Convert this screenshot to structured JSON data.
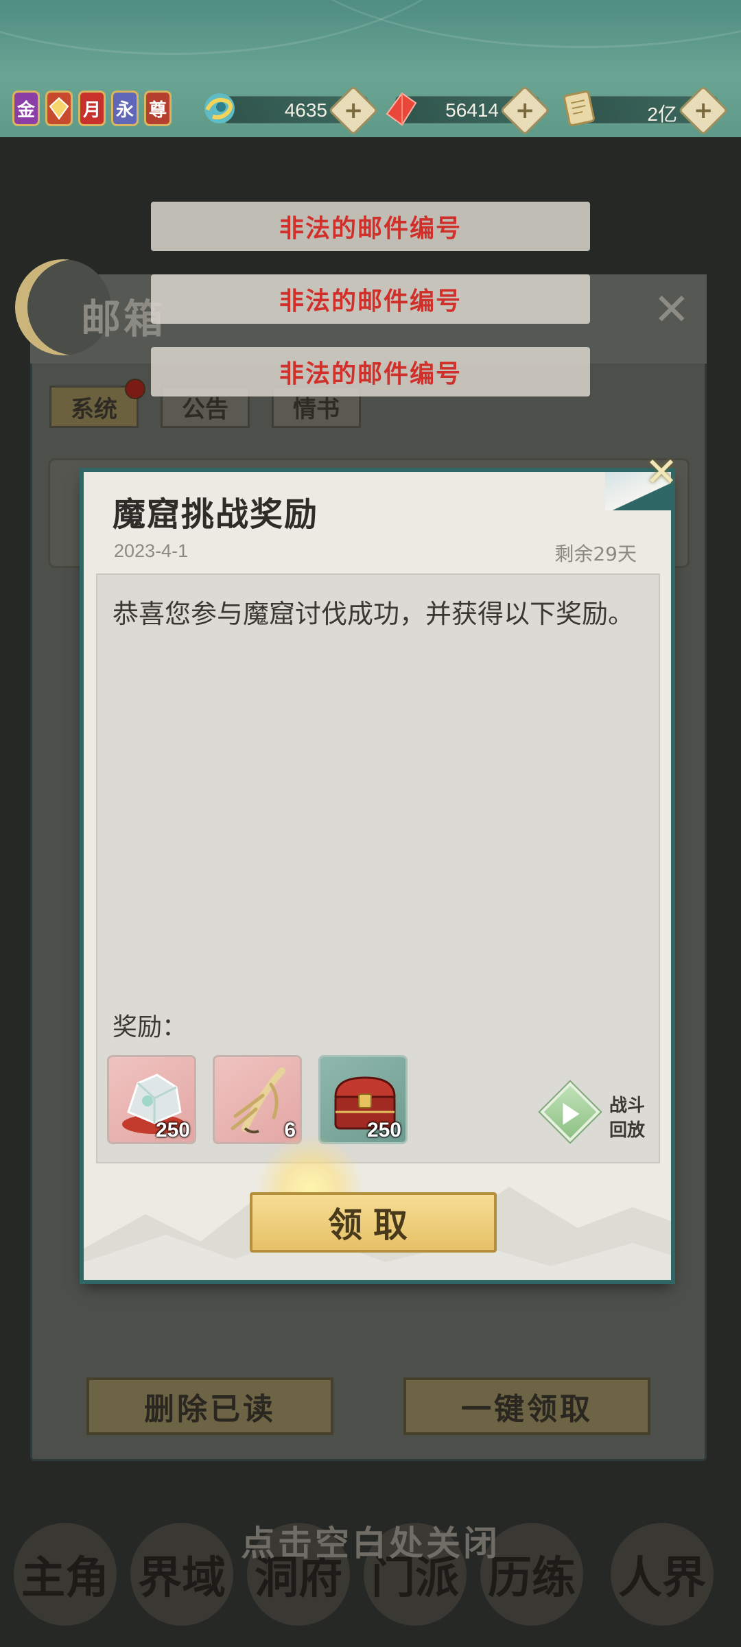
{
  "topbar": {
    "badges": [
      {
        "label": "金",
        "icon": "gold-badge-icon",
        "color": "#8c3ea7"
      },
      {
        "label": "",
        "icon": "treasure-badge-icon",
        "color": "#c84a2e"
      },
      {
        "label": "月",
        "icon": "month-card-icon",
        "color": "#c8302b"
      },
      {
        "label": "永",
        "icon": "permanent-card-icon",
        "color": "#6067b8"
      },
      {
        "label": "尊",
        "icon": "vip-badge-icon",
        "color": "#b6402f"
      }
    ],
    "resources": [
      {
        "icon": "jade-swirl-icon",
        "value": "4635"
      },
      {
        "icon": "red-crystal-icon",
        "value": "56414"
      },
      {
        "icon": "scroll-icon",
        "value": "2亿"
      }
    ]
  },
  "toasts": [
    "非法的邮件编号",
    "非法的邮件编号",
    "非法的邮件编号"
  ],
  "mailbox": {
    "title": "邮箱",
    "tabs": [
      "系统",
      "公告",
      "情书"
    ],
    "delete_read": "删除已读",
    "claim_all": "一键领取"
  },
  "mail": {
    "title": "魔窟挑战奖励",
    "date": "2023-4-1",
    "remaining": "剩余29天",
    "body": "恭喜您参与魔窟讨伐成功，并获得以下奖励。",
    "reward_label": "奖励：",
    "rewards": [
      {
        "icon": "spirit-stone-icon",
        "count": "250"
      },
      {
        "icon": "ginseng-root-icon",
        "count": "6"
      },
      {
        "icon": "treasure-chest-icon",
        "count": "250"
      }
    ],
    "replay_line1": "战斗",
    "replay_line2": "回放",
    "claim": "领取"
  },
  "close_hint": "点击空白处关闭",
  "nav": [
    "主角",
    "界域",
    "洞府",
    "门派",
    "历练",
    "人界"
  ]
}
